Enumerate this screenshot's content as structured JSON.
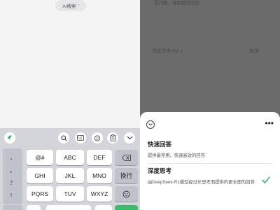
{
  "left": {
    "ai_chip": {
      "label": "AI搜索",
      "chevron": "›"
    },
    "toolbar": {
      "logo_icon": "keyboard-brand-logo-icon",
      "icons": [
        "search-icon",
        "keyboard-icon",
        "emoji-face-icon",
        "clipboard-icon",
        "chevron-down-icon"
      ]
    },
    "keyboard": {
      "punctuation": [
        "，",
        "。",
        "？",
        "！"
      ],
      "rows": [
        [
          "@#",
          "ABC",
          "DEF"
        ],
        [
          "GHI",
          "JKL",
          "MNO"
        ],
        [
          "PQRS",
          "TUV",
          "WXYZ"
        ]
      ],
      "line_break": "换行",
      "send_color": "#3dbb6a"
    }
  },
  "right": {
    "dimmed_text": "提问题、获取解答回答",
    "dimmed_model": "深度思考-R1 ∨",
    "dimmed_send": "发送",
    "sheet": {
      "options": [
        {
          "title": "快速回答",
          "desc": "提供最常用、快速高效的回答",
          "selected": false
        },
        {
          "title": "深度思考",
          "desc": "由DeepSeek-R1模型经过长思考而提供的更全面的回答",
          "selected": true
        }
      ],
      "check_color": "#3dbb6a"
    }
  }
}
